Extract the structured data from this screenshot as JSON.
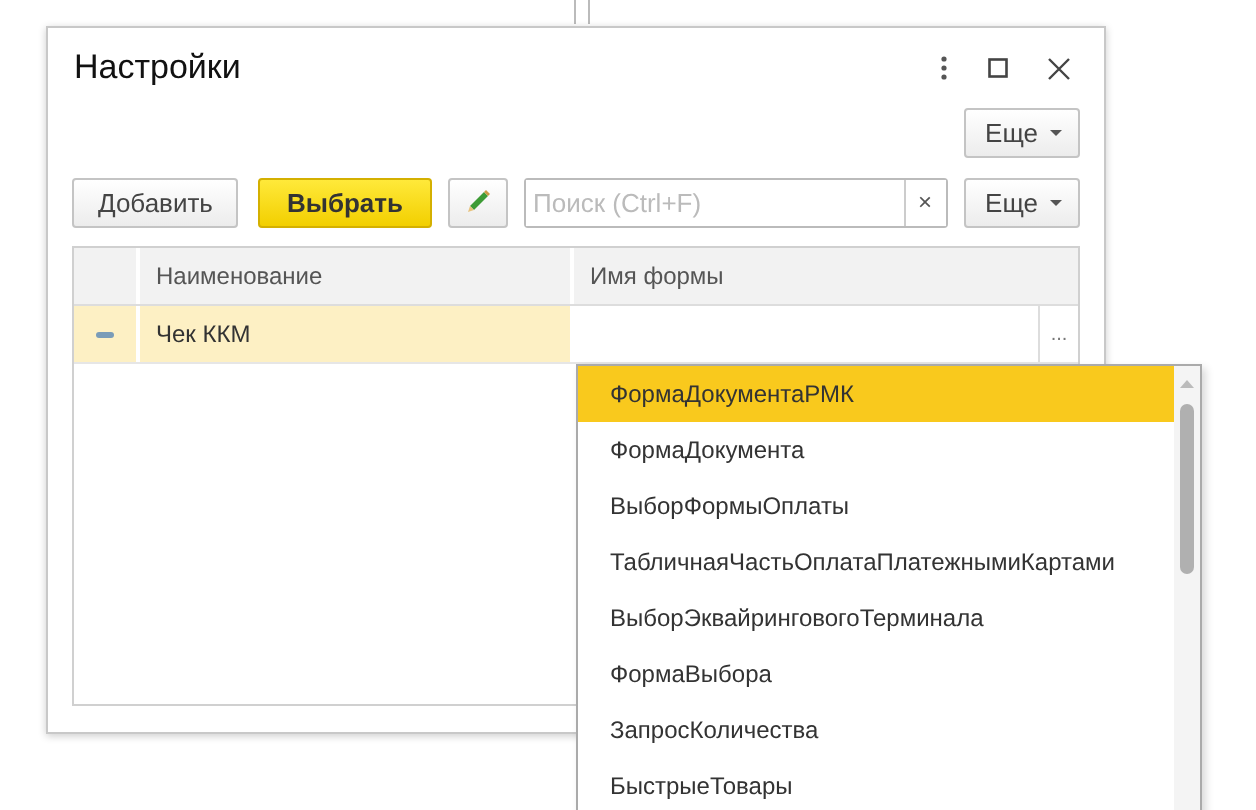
{
  "window": {
    "title": "Настройки",
    "more_button": "Еще"
  },
  "toolbar": {
    "buttons": [
      {
        "label": "Добавить",
        "kind": "default"
      },
      {
        "label": "Выбрать",
        "kind": "primary"
      }
    ],
    "search": {
      "placeholder": "Поиск (Ctrl+F)",
      "clear": "×"
    },
    "more_button": "Еще"
  },
  "table": {
    "columns": [
      "Наименование",
      "Имя формы"
    ],
    "rows": [
      {
        "name": "Чек ККМ",
        "picker": "...",
        "selected": true
      }
    ]
  },
  "dropdown": {
    "items": [
      {
        "label": "ФормаДокументаРМК",
        "selected": true
      },
      {
        "label": "ФормаДокумента",
        "selected": false
      },
      {
        "label": "ВыборФормыОплаты",
        "selected": false
      },
      {
        "label": "ТабличнаяЧастьОплатаПлатежнымиКартами",
        "selected": false
      },
      {
        "label": "ВыборЭквайринговогоТерминала",
        "selected": false
      },
      {
        "label": "ФормаВыбора",
        "selected": false
      },
      {
        "label": "ЗапросКоличества",
        "selected": false
      },
      {
        "label": "БыстрыеТовары",
        "selected": false
      }
    ]
  }
}
